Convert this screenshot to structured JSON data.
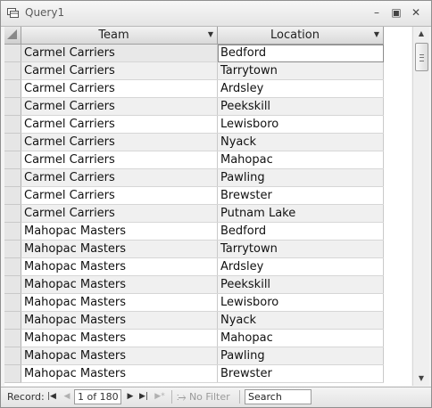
{
  "window": {
    "title": "Query1"
  },
  "columns": [
    {
      "label": "Team"
    },
    {
      "label": "Location"
    }
  ],
  "rows": [
    {
      "team": "Carmel Carriers",
      "location": "Bedford"
    },
    {
      "team": "Carmel Carriers",
      "location": "Tarrytown"
    },
    {
      "team": "Carmel Carriers",
      "location": "Ardsley"
    },
    {
      "team": "Carmel Carriers",
      "location": "Peekskill"
    },
    {
      "team": "Carmel Carriers",
      "location": "Lewisboro"
    },
    {
      "team": "Carmel Carriers",
      "location": "Nyack"
    },
    {
      "team": "Carmel Carriers",
      "location": "Mahopac"
    },
    {
      "team": "Carmel Carriers",
      "location": "Pawling"
    },
    {
      "team": "Carmel Carriers",
      "location": "Brewster"
    },
    {
      "team": "Carmel Carriers",
      "location": "Putnam Lake"
    },
    {
      "team": "Mahopac Masters",
      "location": "Bedford"
    },
    {
      "team": "Mahopac Masters",
      "location": "Tarrytown"
    },
    {
      "team": "Mahopac Masters",
      "location": "Ardsley"
    },
    {
      "team": "Mahopac Masters",
      "location": "Peekskill"
    },
    {
      "team": "Mahopac Masters",
      "location": "Lewisboro"
    },
    {
      "team": "Mahopac Masters",
      "location": "Nyack"
    },
    {
      "team": "Mahopac Masters",
      "location": "Mahopac"
    },
    {
      "team": "Mahopac Masters",
      "location": "Pawling"
    },
    {
      "team": "Mahopac Masters",
      "location": "Brewster"
    }
  ],
  "navigation": {
    "record_label": "Record:",
    "record_position": "1 of 180",
    "filter_label": "No Filter",
    "search_placeholder": "Search"
  }
}
